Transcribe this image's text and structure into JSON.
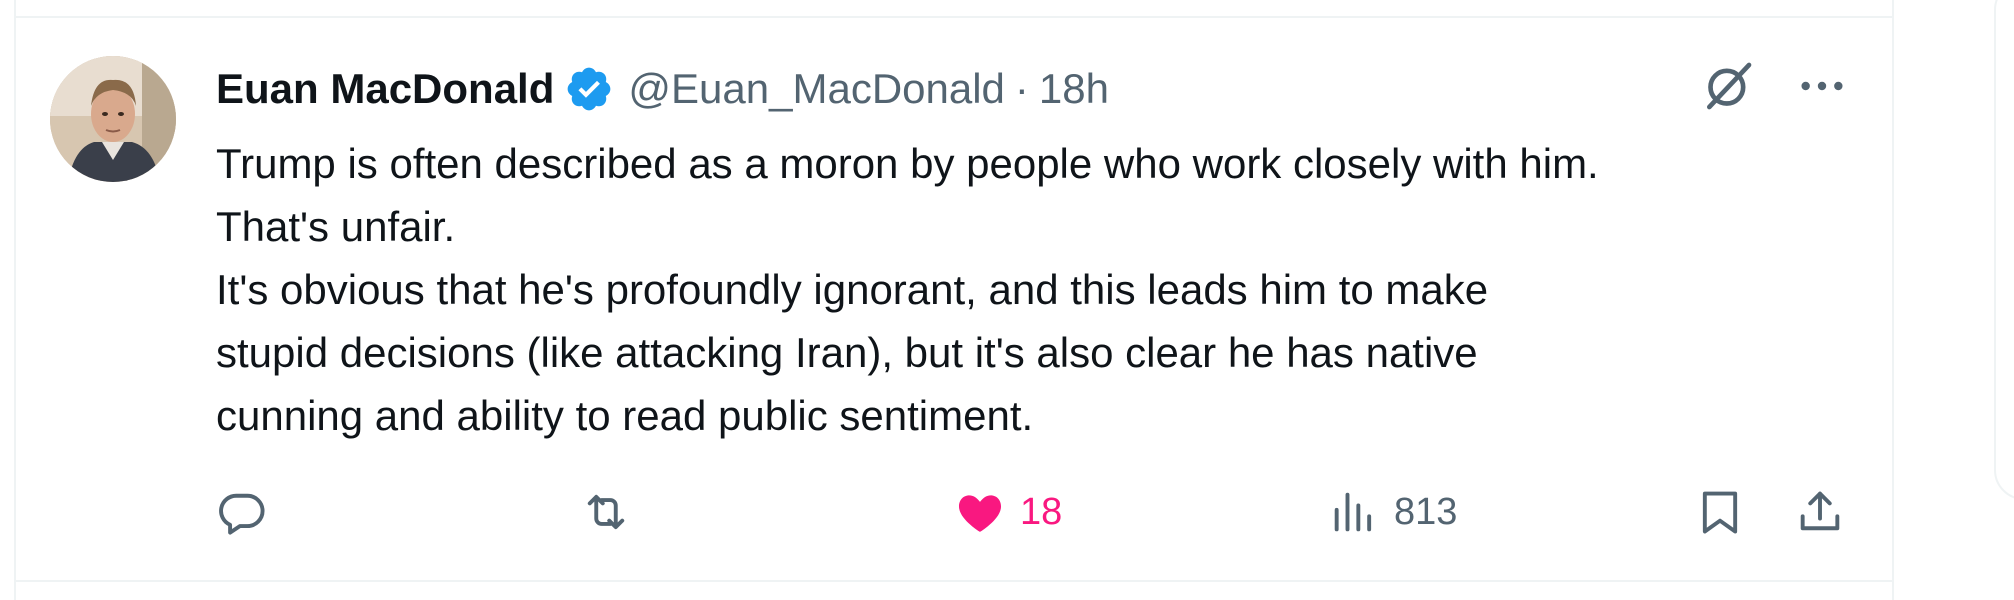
{
  "tweet": {
    "author_name": "Euan MacDonald",
    "handle": "@Euan_MacDonald",
    "separator": "·",
    "time": "18h",
    "text_lines": [
      "Trump is often described as a moron by people who work closely with him.",
      "That's unfair.",
      "It's obvious that he's profoundly ignorant, and this leads him to make",
      "stupid decisions (like attacking Iran), but it's also clear he has native",
      "cunning and ability to read public sentiment."
    ]
  },
  "actions": {
    "replies": "",
    "retweets": "",
    "likes": "18",
    "views": "813"
  },
  "icons": {
    "verified": "verified-badge-icon",
    "grok": "grok-icon",
    "more": "more-dots-icon",
    "reply": "reply-icon",
    "retweet": "retweet-icon",
    "like": "heart-icon",
    "views": "views-chart-icon",
    "bookmark": "bookmark-icon",
    "share": "share-icon"
  },
  "colors": {
    "text": "#0f1419",
    "secondary": "#536471",
    "verified": "#1d9bf0",
    "like": "#f91880",
    "border": "#eff3f4"
  }
}
